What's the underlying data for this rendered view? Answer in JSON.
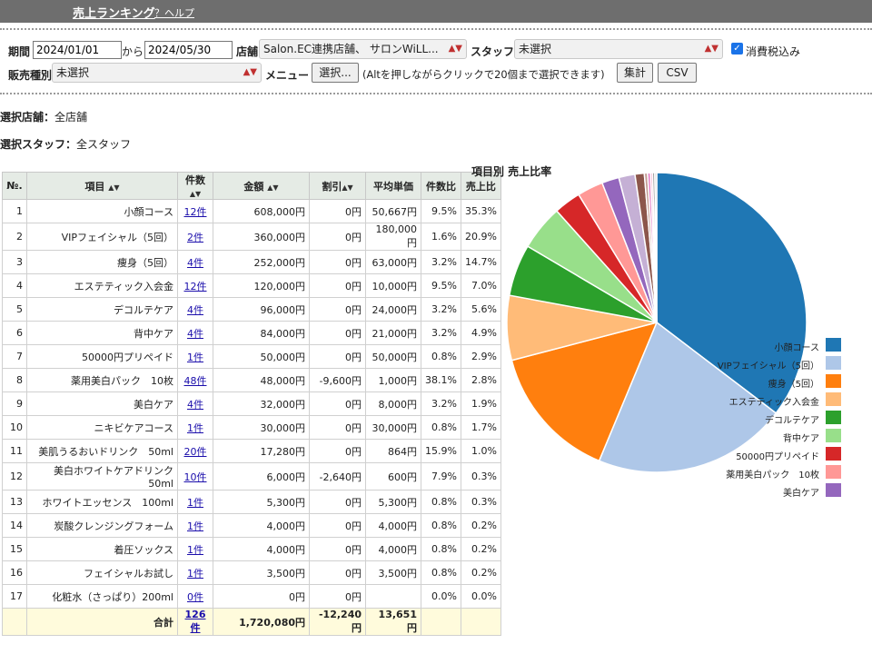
{
  "header": {
    "title": "売上ランキング",
    "help": "？ヘルプ"
  },
  "filters": {
    "period_label": "期間",
    "date_from": "2024/01/01",
    "kara": "から",
    "date_to": "2024/05/30",
    "store_label": "店舗",
    "store_value": "Salon.EC連携店舗、 サロンWiLL...",
    "staff_label": "スタッフ",
    "staff_value": "未選択",
    "tax_label": "消費税込み",
    "tax_checked": true,
    "sales_type_label": "販売種別",
    "sales_type_value": "未選択",
    "menu_label": "メニュー",
    "select_button": "選択...",
    "hint": "(Altを押しながらクリックで20個まで選択できます)",
    "aggregate_button": "集計",
    "csv_button": "CSV"
  },
  "selection": {
    "store_label": "選択店舗：",
    "store_value": "全店舗",
    "staff_label": "選択スタッフ：",
    "staff_value": "全スタッフ"
  },
  "table": {
    "headers": [
      "№.",
      "項目",
      "件数",
      "金額",
      "割引",
      "平均単価",
      "件数比",
      "売上比"
    ],
    "rows": [
      {
        "no": "1",
        "item": "小顔コース",
        "count": "12件",
        "amount": "608,000円",
        "discount": "0円",
        "avg": "50,667円",
        "count_ratio": "9.5%",
        "sales_ratio": "35.3%"
      },
      {
        "no": "2",
        "item": "VIPフェイシャル（5回）",
        "count": "2件",
        "amount": "360,000円",
        "discount": "0円",
        "avg": "180,000円",
        "count_ratio": "1.6%",
        "sales_ratio": "20.9%"
      },
      {
        "no": "3",
        "item": "痩身（5回）",
        "count": "4件",
        "amount": "252,000円",
        "discount": "0円",
        "avg": "63,000円",
        "count_ratio": "3.2%",
        "sales_ratio": "14.7%"
      },
      {
        "no": "4",
        "item": "エステティック入会金",
        "count": "12件",
        "amount": "120,000円",
        "discount": "0円",
        "avg": "10,000円",
        "count_ratio": "9.5%",
        "sales_ratio": "7.0%"
      },
      {
        "no": "5",
        "item": "デコルテケア",
        "count": "4件",
        "amount": "96,000円",
        "discount": "0円",
        "avg": "24,000円",
        "count_ratio": "3.2%",
        "sales_ratio": "5.6%"
      },
      {
        "no": "6",
        "item": "背中ケア",
        "count": "4件",
        "amount": "84,000円",
        "discount": "0円",
        "avg": "21,000円",
        "count_ratio": "3.2%",
        "sales_ratio": "4.9%"
      },
      {
        "no": "7",
        "item": "50000円プリペイド",
        "count": "1件",
        "amount": "50,000円",
        "discount": "0円",
        "avg": "50,000円",
        "count_ratio": "0.8%",
        "sales_ratio": "2.9%"
      },
      {
        "no": "8",
        "item": "薬用美白パック　10枚",
        "count": "48件",
        "amount": "48,000円",
        "discount": "-9,600円",
        "avg": "1,000円",
        "count_ratio": "38.1%",
        "sales_ratio": "2.8%"
      },
      {
        "no": "9",
        "item": "美白ケア",
        "count": "4件",
        "amount": "32,000円",
        "discount": "0円",
        "avg": "8,000円",
        "count_ratio": "3.2%",
        "sales_ratio": "1.9%"
      },
      {
        "no": "10",
        "item": "ニキビケアコース",
        "count": "1件",
        "amount": "30,000円",
        "discount": "0円",
        "avg": "30,000円",
        "count_ratio": "0.8%",
        "sales_ratio": "1.7%"
      },
      {
        "no": "11",
        "item": "美肌うるおいドリンク　50ml",
        "count": "20件",
        "amount": "17,280円",
        "discount": "0円",
        "avg": "864円",
        "count_ratio": "15.9%",
        "sales_ratio": "1.0%"
      },
      {
        "no": "12",
        "item": "美白ホワイトケアドリンク　50ml",
        "count": "10件",
        "amount": "6,000円",
        "discount": "-2,640円",
        "avg": "600円",
        "count_ratio": "7.9%",
        "sales_ratio": "0.3%"
      },
      {
        "no": "13",
        "item": "ホワイトエッセンス　100ml",
        "count": "1件",
        "amount": "5,300円",
        "discount": "0円",
        "avg": "5,300円",
        "count_ratio": "0.8%",
        "sales_ratio": "0.3%"
      },
      {
        "no": "14",
        "item": "炭酸クレンジングフォーム",
        "count": "1件",
        "amount": "4,000円",
        "discount": "0円",
        "avg": "4,000円",
        "count_ratio": "0.8%",
        "sales_ratio": "0.2%"
      },
      {
        "no": "15",
        "item": "着圧ソックス",
        "count": "1件",
        "amount": "4,000円",
        "discount": "0円",
        "avg": "4,000円",
        "count_ratio": "0.8%",
        "sales_ratio": "0.2%"
      },
      {
        "no": "16",
        "item": "フェイシャルお試し",
        "count": "1件",
        "amount": "3,500円",
        "discount": "0円",
        "avg": "3,500円",
        "count_ratio": "0.8%",
        "sales_ratio": "0.2%"
      },
      {
        "no": "17",
        "item": "化粧水（さっぱり）200ml",
        "count": "0件",
        "amount": "0円",
        "discount": "0円",
        "avg": "",
        "count_ratio": "0.0%",
        "sales_ratio": "0.0%"
      }
    ],
    "total": {
      "label": "合計",
      "count": "126件",
      "amount": "1,720,080円",
      "discount": "-12,240円",
      "avg": "13,651円"
    }
  },
  "chart_data": {
    "type": "pie",
    "title": "項目別 売上比率",
    "categories": [
      "小顔コース",
      "VIPフェイシャル（5回）",
      "痩身（5回）",
      "エステティック入会金",
      "デコルテケア",
      "背中ケア",
      "50000円プリペイド",
      "薬用美白パック　10枚",
      "美白ケア",
      "ニキビケアコース",
      "美肌うるおいドリンク　50ml",
      "美白ホワイトケアドリンク　50ml",
      "ホワイトエッセンス　100ml",
      "炭酸クレンジングフォーム",
      "着圧ソックス",
      "フェイシャルお試し",
      "化粧水（さっぱり）200ml"
    ],
    "values": [
      608000,
      360000,
      252000,
      120000,
      96000,
      84000,
      50000,
      48000,
      32000,
      30000,
      17280,
      6000,
      5300,
      4000,
      4000,
      3500,
      0
    ],
    "colors": [
      "#1f77b4",
      "#aec7e8",
      "#ff7f0e",
      "#ffbb78",
      "#2ca02c",
      "#98df8a",
      "#d62728",
      "#ff9896",
      "#9467bd",
      "#c5b0d5",
      "#8c564b",
      "#c49c94",
      "#e377c2",
      "#f7b6d2",
      "#7f7f7f",
      "#c7c7c7",
      "#bcbd22"
    ],
    "legend_labels": [
      "小顔コース",
      "VIPフェイシャル（5回）",
      "痩身（5回）",
      "エステティック入会金",
      "デコルテケア",
      "背中ケア",
      "50000円プリペイド",
      "薬用美白パック　10枚",
      "美白ケア"
    ],
    "legend_position": "right"
  }
}
